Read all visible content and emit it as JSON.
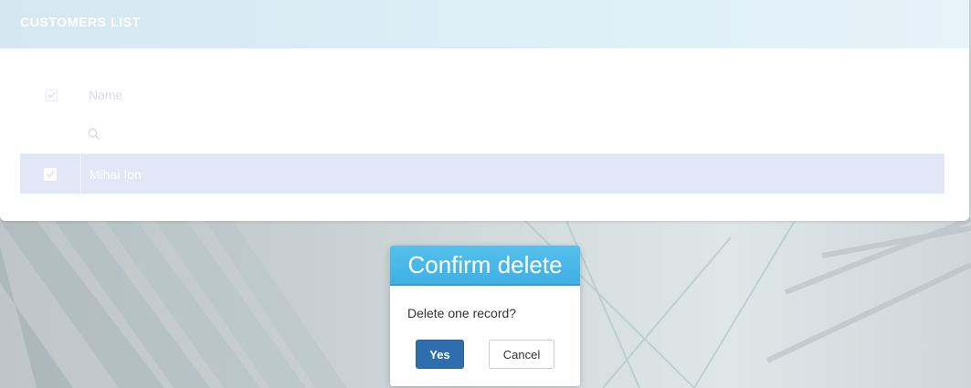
{
  "card": {
    "title": "CUSTOMERS LIST"
  },
  "grid": {
    "header_checkbox_checked": true,
    "columns": [
      "Name"
    ],
    "rows": [
      {
        "checked": true,
        "name": "Mihai Ion"
      }
    ]
  },
  "dialog": {
    "title": "Confirm delete",
    "message": "Delete one record?",
    "yes_label": "Yes",
    "cancel_label": "Cancel"
  },
  "icons": {
    "search": "search-icon",
    "check": "checkmark-icon"
  },
  "colors": {
    "header_bg": "#d5e8f2",
    "selected_row": "#e3e6f6",
    "dialog_header": "#48b8e8",
    "yes_button": "#2f6eac"
  }
}
